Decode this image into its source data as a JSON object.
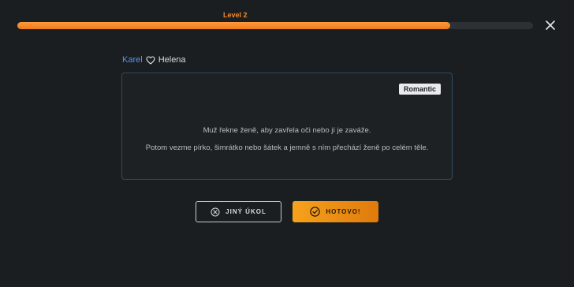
{
  "progress": {
    "level_label": "Level 2",
    "fraction": 0.84,
    "color": "#f08a2c"
  },
  "close": {
    "icon": "close-icon"
  },
  "players": {
    "player1": "Karel",
    "player2": "Helena",
    "icon": "heart-icon"
  },
  "card": {
    "category": "Romantic",
    "line1": "Muž řekne ženě, aby zavřela oči nebo jí je zaváže.",
    "line2": "Potom vezme pírko, šimrátko nebo šátek a jemně s ním přechází ženě po celém těle."
  },
  "buttons": {
    "other_label": "JINÝ ÚKOL",
    "other_icon": "close-circle-icon",
    "done_label": "HOTOVO!",
    "done_icon": "check-circle-icon"
  }
}
